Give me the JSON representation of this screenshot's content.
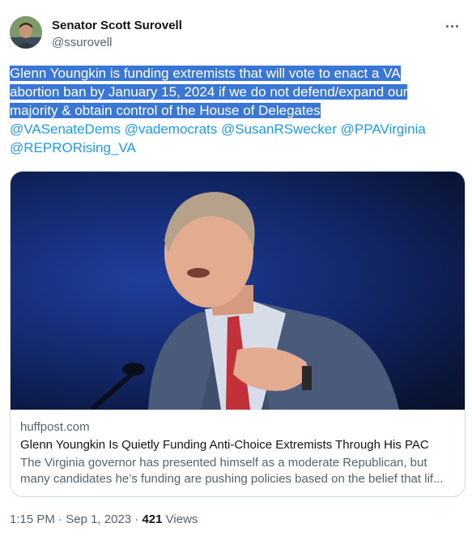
{
  "author": {
    "display_name": "Senator Scott Surovell",
    "handle": "@ssurovell"
  },
  "tweet": {
    "text_lines": [
      "Glenn Youngkin is funding extremists that will vote to enact a VA",
      "abortion ban by January 15, 2024 if we do not defend/expand our",
      "majority & obtain control of the House of Delegates"
    ],
    "mentions": [
      "@VASenateDems",
      "@vademocrats",
      "@SusanRSwecker",
      "@PPAVirginia",
      "@REPRORising_VA"
    ]
  },
  "link_card": {
    "domain": "huffpost.com",
    "title": "Glenn Youngkin Is Quietly Funding Anti-Choice Extremists Through His PAC",
    "description_lines": [
      "The Virginia governor has presented himself as a moderate Republican, but",
      "many candidates he’s funding are pushing policies based on the belief that lif..."
    ]
  },
  "meta": {
    "time": "1:15 PM",
    "separator": "·",
    "date": "Sep 1, 2023",
    "views_count": "421",
    "views_label": "Views"
  },
  "colors": {
    "highlight": "#3a76d6",
    "link": "#1d9bf0",
    "muted": "#536471"
  }
}
